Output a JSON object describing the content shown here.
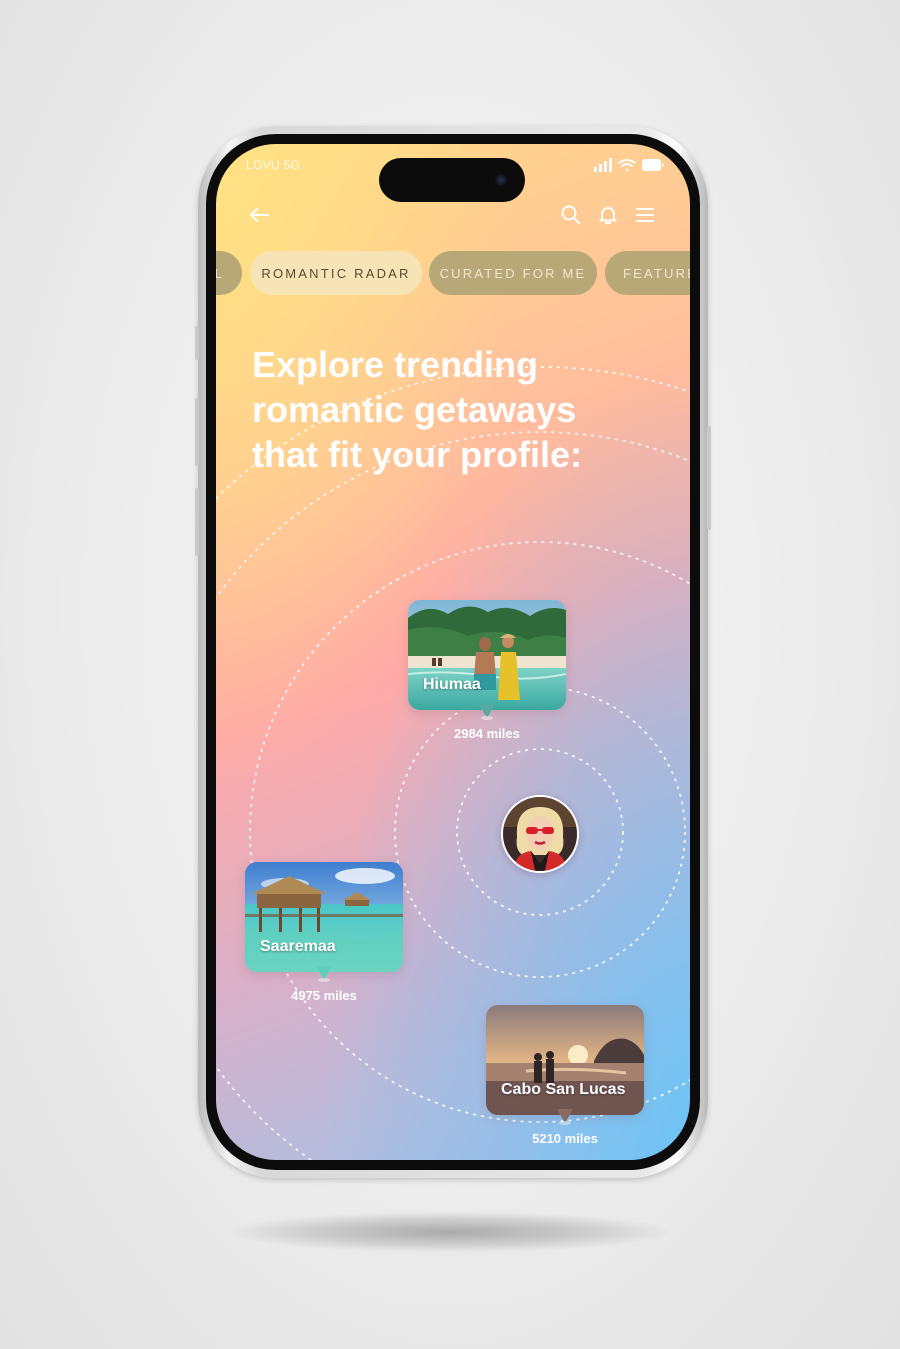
{
  "status_bar": {
    "carrier": "LOVU 5G"
  },
  "nav": {
    "back_icon": "arrow-left-icon",
    "icons": [
      "search-icon",
      "bell-icon",
      "menu-icon"
    ]
  },
  "tabs": [
    {
      "label": "L",
      "state": "inactive",
      "partial": true
    },
    {
      "label": "ROMANTIC RADAR",
      "state": "active"
    },
    {
      "label": "CURATED FOR ME",
      "state": "inactive"
    },
    {
      "label": "FEATURE",
      "state": "inactive",
      "partial": true
    }
  ],
  "headline": {
    "line1": "Explore trending",
    "line2": "romantic getaways",
    "line3": "that fit your profile:"
  },
  "destinations": [
    {
      "name": "Hiumaa",
      "distance": "2984 miles"
    },
    {
      "name": "Saaremaa",
      "distance": "4975 miles"
    },
    {
      "name": "Cabo San Lucas",
      "distance": "5210 miles"
    }
  ],
  "colors": {
    "tab_active_bg": "#f7e4b6",
    "tab_inactive_bg": "#b8a877",
    "headline": "#ffffff"
  }
}
